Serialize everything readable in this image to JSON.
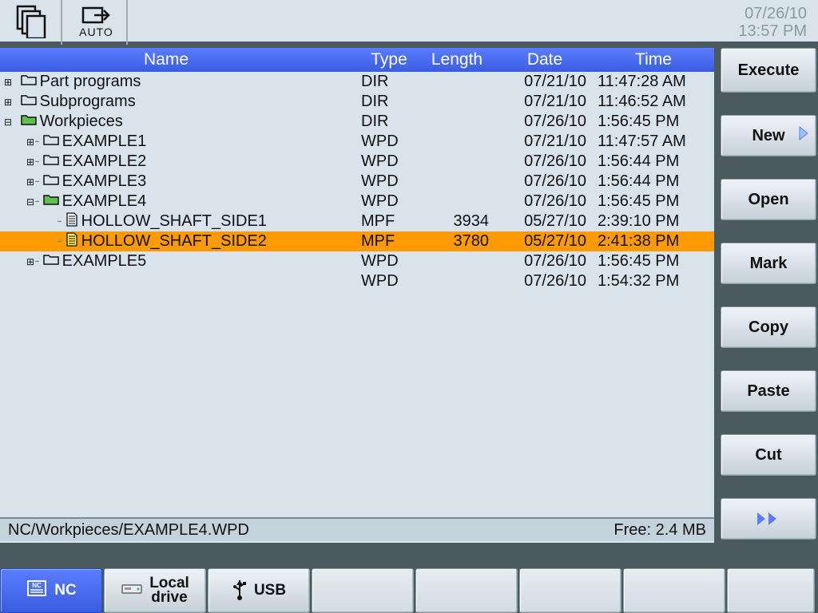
{
  "header": {
    "date": "07/26/10",
    "time": "13:57 PM",
    "auto_label": "AUTO"
  },
  "columns": {
    "name": "Name",
    "type": "Type",
    "length": "Length",
    "date": "Date",
    "time": "Time"
  },
  "rows": [
    {
      "indent": 0,
      "toggle": "+",
      "icon": "folder",
      "open": false,
      "name": "Part programs",
      "type": "DIR",
      "length": "",
      "date": "07/21/10",
      "time": "11:47:28 AM",
      "selected": false
    },
    {
      "indent": 0,
      "toggle": "+",
      "icon": "folder",
      "open": false,
      "name": "Subprograms",
      "type": "DIR",
      "length": "",
      "date": "07/21/10",
      "time": "11:46:52 AM",
      "selected": false
    },
    {
      "indent": 0,
      "toggle": "-",
      "icon": "folder",
      "open": true,
      "name": "Workpieces",
      "type": "DIR",
      "length": "",
      "date": "07/26/10",
      "time": "1:56:45 PM",
      "selected": false
    },
    {
      "indent": 1,
      "toggle": "+",
      "icon": "folder",
      "open": false,
      "name": "EXAMPLE1",
      "type": "WPD",
      "length": "",
      "date": "07/21/10",
      "time": "11:47:57 AM",
      "selected": false
    },
    {
      "indent": 1,
      "toggle": "+",
      "icon": "folder",
      "open": false,
      "name": "EXAMPLE2",
      "type": "WPD",
      "length": "",
      "date": "07/26/10",
      "time": "1:56:44 PM",
      "selected": false
    },
    {
      "indent": 1,
      "toggle": "+",
      "icon": "folder",
      "open": false,
      "name": "EXAMPLE3",
      "type": "WPD",
      "length": "",
      "date": "07/26/10",
      "time": "1:56:44 PM",
      "selected": false
    },
    {
      "indent": 1,
      "toggle": "-",
      "icon": "folder",
      "open": true,
      "name": "EXAMPLE4",
      "type": "WPD",
      "length": "",
      "date": "07/26/10",
      "time": "1:56:45 PM",
      "selected": false
    },
    {
      "indent": 2,
      "toggle": "",
      "icon": "file",
      "open": false,
      "name": "HOLLOW_SHAFT_SIDE1",
      "type": "MPF",
      "length": "3934",
      "date": "05/27/10",
      "time": "2:39:10 PM",
      "selected": false
    },
    {
      "indent": 2,
      "toggle": "",
      "icon": "file",
      "open": false,
      "name": "HOLLOW_SHAFT_SIDE2",
      "type": "MPF",
      "length": "3780",
      "date": "05/27/10",
      "time": "2:41:38 PM",
      "selected": true
    },
    {
      "indent": 1,
      "toggle": "+",
      "icon": "folder",
      "open": false,
      "name": "EXAMPLE5",
      "type": "WPD",
      "length": "",
      "date": "07/26/10",
      "time": "1:56:45 PM",
      "selected": false
    },
    {
      "indent": 1,
      "toggle": "",
      "icon": "none",
      "open": false,
      "name": "",
      "type": "WPD",
      "length": "",
      "date": "07/26/10",
      "time": "1:54:32 PM",
      "selected": false
    }
  ],
  "status": {
    "path": "NC/Workpieces/EXAMPLE4.WPD",
    "free": "Free: 2.4 MB"
  },
  "softkeys_right": {
    "execute": "Execute",
    "new": "New",
    "open": "Open",
    "mark": "Mark",
    "copy": "Copy",
    "paste": "Paste",
    "cut": "Cut"
  },
  "softkeys_bottom": {
    "nc": "NC",
    "local_drive": "Local\ndrive",
    "usb": "USB"
  }
}
